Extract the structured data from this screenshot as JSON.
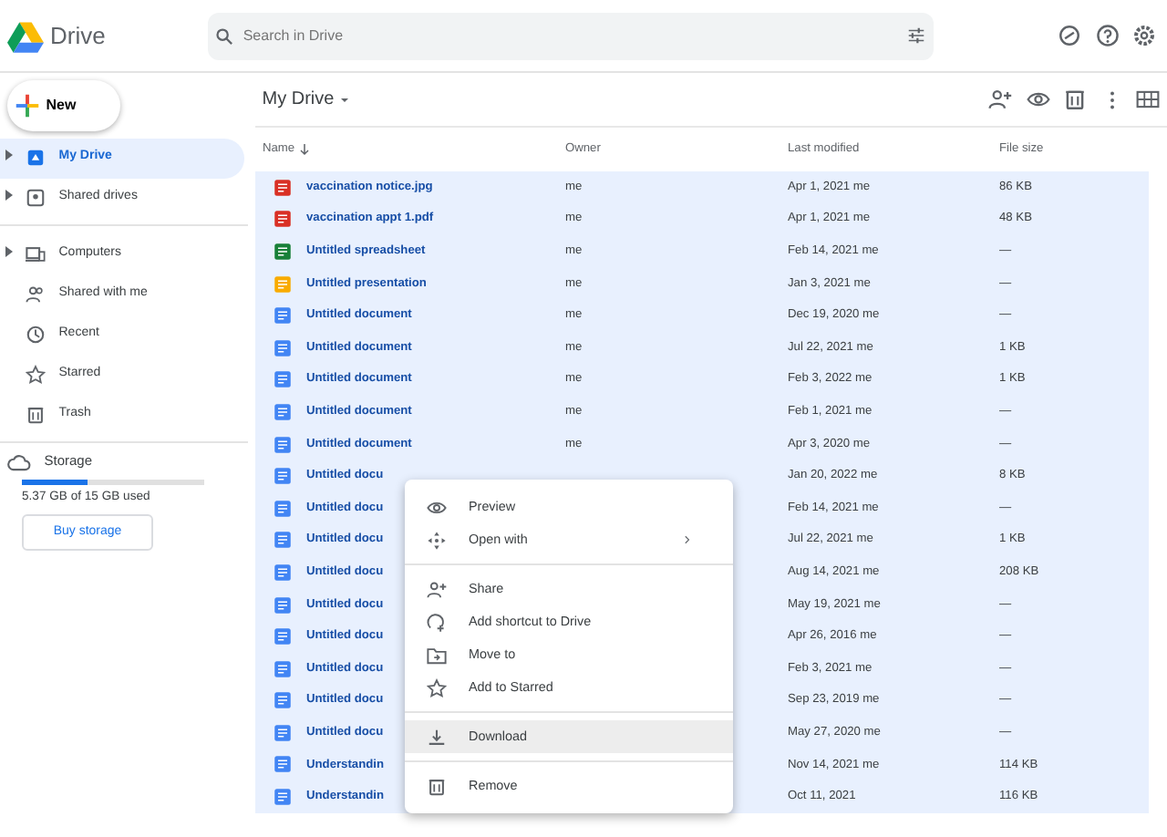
{
  "app": {
    "title": "Drive"
  },
  "search": {
    "placeholder": "Search in Drive"
  },
  "new_button": {
    "label": "New"
  },
  "sidebar": {
    "sections": [
      {
        "items": [
          {
            "label": "My Drive",
            "kind": "drive",
            "expandable": true,
            "selected": true
          },
          {
            "label": "Shared drives",
            "kind": "shared-drives",
            "expandable": true,
            "selected": false
          }
        ]
      },
      {
        "items": [
          {
            "label": "Computers",
            "kind": "computers",
            "expandable": true,
            "selected": false
          },
          {
            "label": "Shared with me",
            "kind": "people",
            "expandable": false,
            "selected": false
          },
          {
            "label": "Recent",
            "kind": "clock",
            "expandable": false,
            "selected": false
          },
          {
            "label": "Starred",
            "kind": "star",
            "expandable": false,
            "selected": false
          },
          {
            "label": "Trash",
            "kind": "trash",
            "expandable": false,
            "selected": false
          }
        ]
      }
    ],
    "storage": {
      "label": "Storage",
      "level": 0.36,
      "usage": "5.37 GB of 15 GB used",
      "button": "Buy storage"
    }
  },
  "breadcrumb": {
    "title": "My Drive"
  },
  "table": {
    "columns": [
      "Name",
      "Owner",
      "Last modified",
      "File size"
    ],
    "rows": [
      {
        "kind": "image",
        "name": "vaccination notice.jpg",
        "owner": "me",
        "modified": "Apr 1, 2021 me",
        "size": "86 KB",
        "selected": true
      },
      {
        "kind": "pdf",
        "name": "vaccination appt 1.pdf",
        "owner": "me",
        "modified": "Apr 1, 2021 me",
        "size": "48 KB",
        "selected": true
      },
      {
        "kind": "sheet",
        "name": "Untitled spreadsheet",
        "owner": "me",
        "modified": "Feb 14, 2021 me",
        "size": "—",
        "selected": true
      },
      {
        "kind": "slides",
        "name": "Untitled presentation",
        "owner": "me",
        "modified": "Jan 3, 2021 me",
        "size": "—",
        "selected": true
      },
      {
        "kind": "doc",
        "name": "Untitled document",
        "owner": "me",
        "modified": "Dec 19, 2020 me",
        "size": "—",
        "selected": true
      },
      {
        "kind": "doc",
        "name": "Untitled document",
        "owner": "me",
        "modified": "Jul 22, 2021 me",
        "size": "1 KB",
        "selected": true
      },
      {
        "kind": "doc",
        "name": "Untitled document",
        "owner": "me",
        "modified": "Feb 3, 2022 me",
        "size": "1 KB",
        "selected": true
      },
      {
        "kind": "doc",
        "name": "Untitled document",
        "owner": "me",
        "modified": "Feb 1, 2021 me",
        "size": "—",
        "selected": true
      },
      {
        "kind": "doc",
        "name": "Untitled document",
        "owner": "me",
        "modified": "Apr 3, 2020 me",
        "size": "—",
        "selected": true
      },
      {
        "kind": "doc",
        "name": "Untitled docu",
        "modified": "Jan 20, 2022 me",
        "size": "8 KB",
        "selected": true
      },
      {
        "kind": "doc",
        "name": "Untitled docu",
        "modified": "Feb 14, 2021 me",
        "size": "—",
        "selected": true
      },
      {
        "kind": "doc",
        "name": "Untitled docu",
        "modified": "Jul 22, 2021 me",
        "size": "1 KB",
        "selected": true
      },
      {
        "kind": "doc",
        "name": "Untitled docu",
        "modified": "Aug 14, 2021 me",
        "size": "208 KB",
        "selected": true
      },
      {
        "kind": "doc",
        "name": "Untitled docu",
        "modified": "May 19, 2021 me",
        "size": "—",
        "selected": true
      },
      {
        "kind": "doc",
        "name": "Untitled docu",
        "modified": "Apr 26, 2016 me",
        "size": "—",
        "selected": true
      },
      {
        "kind": "doc",
        "name": "Untitled docu",
        "modified": "Feb 3, 2021 me",
        "size": "—",
        "selected": true
      },
      {
        "kind": "doc",
        "name": "Untitled docu",
        "modified": "Sep 23, 2019 me",
        "size": "—",
        "selected": true
      },
      {
        "kind": "doc",
        "name": "Untitled docu",
        "modified": "May 27, 2020 me",
        "size": "—",
        "selected": true
      },
      {
        "kind": "doc",
        "name": "Understandin",
        "modified": "Nov 14, 2021 me",
        "size": "114 KB",
        "selected": true
      },
      {
        "kind": "doc",
        "name": "Understandin",
        "modified": "Oct 11, 2021",
        "size": "116 KB",
        "selected": true
      }
    ]
  },
  "context_menu": {
    "groups": [
      {
        "items": [
          {
            "label": "Preview",
            "kind": "eye",
            "submenu": false,
            "highlighted": false
          },
          {
            "label": "Open with",
            "kind": "move",
            "submenu": true,
            "highlighted": false
          }
        ]
      },
      {
        "items": [
          {
            "label": "Share",
            "kind": "person-add",
            "submenu": false,
            "highlighted": false
          },
          {
            "label": "Add shortcut to Drive",
            "kind": "shortcut",
            "submenu": false,
            "highlighted": false
          },
          {
            "label": "Move to",
            "kind": "folder",
            "submenu": false,
            "highlighted": false
          },
          {
            "label": "Add to Starred",
            "kind": "star",
            "submenu": false,
            "highlighted": false
          }
        ]
      },
      {
        "items": [
          {
            "label": "Download",
            "kind": "download",
            "submenu": false,
            "highlighted": true
          }
        ]
      },
      {
        "items": [
          {
            "label": "Remove",
            "kind": "trash",
            "submenu": false,
            "highlighted": false
          }
        ]
      }
    ]
  }
}
